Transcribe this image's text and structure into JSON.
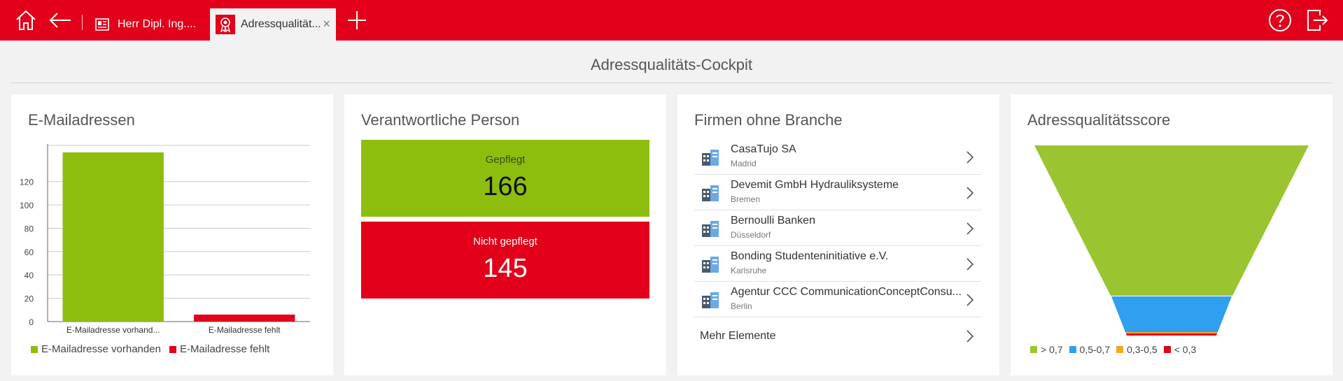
{
  "topbar": {
    "tabs": [
      {
        "label": "Herr Dipl. Ing...."
      },
      {
        "label": "Adressqualität..."
      }
    ],
    "close_glyph": "×"
  },
  "page": {
    "title": "Adressqualitäts-Cockpit"
  },
  "email_card": {
    "title": "E-Mailadressen"
  },
  "chart_data": {
    "type": "bar",
    "categories": [
      "E-Mailadresse vorhanden",
      "E-Mailadresse fehlt"
    ],
    "category_tick_labels": [
      "E-Mailadresse vorhand...",
      "E-Mailadresse fehlt"
    ],
    "values": [
      145,
      6
    ],
    "colors": [
      "#8dbe0e",
      "#e2001a"
    ],
    "ylim": [
      0,
      145
    ],
    "yticks": [
      0,
      20,
      40,
      60,
      80,
      100,
      120
    ],
    "grid": true,
    "legend": [
      {
        "label": "E-Mailadresse vorhanden",
        "color": "#8dbe0e"
      },
      {
        "label": "E-Mailadresse fehlt",
        "color": "#e2001a"
      }
    ],
    "legend_position": "bottom"
  },
  "person_card": {
    "title": "Verantwortliche Person",
    "tiles": [
      {
        "label": "Gepflegt",
        "value": "166",
        "color": "#8dbe0e"
      },
      {
        "label": "Nicht gepflegt",
        "value": "145",
        "color": "#e2001a"
      }
    ]
  },
  "firms_card": {
    "title": "Firmen ohne Branche",
    "items": [
      {
        "name": "CasaTujo SA",
        "city": "Madrid"
      },
      {
        "name": "Devemit GmbH Hydrauliksysteme",
        "city": "Bremen"
      },
      {
        "name": "Bernoulli Banken",
        "city": "Düsseldorf"
      },
      {
        "name": "Bonding Studenteninitiative e.V.",
        "city": "Karlsruhe"
      },
      {
        "name": "Agentur CCC CommunicationConceptConsu...",
        "city": "Berlin"
      }
    ],
    "more_label": "Mehr Elemente",
    "icon": "building-icon"
  },
  "score_card": {
    "title": "Adressqualitätsscore",
    "funnel": [
      {
        "label": "> 0,7",
        "color": "#9bc431"
      },
      {
        "label": "0,5-0,7",
        "color": "#2f9ff0"
      },
      {
        "label": "0,3-0,5",
        "color": "#f5a623"
      },
      {
        "label": "< 0,3",
        "color": "#e2001a"
      }
    ]
  }
}
